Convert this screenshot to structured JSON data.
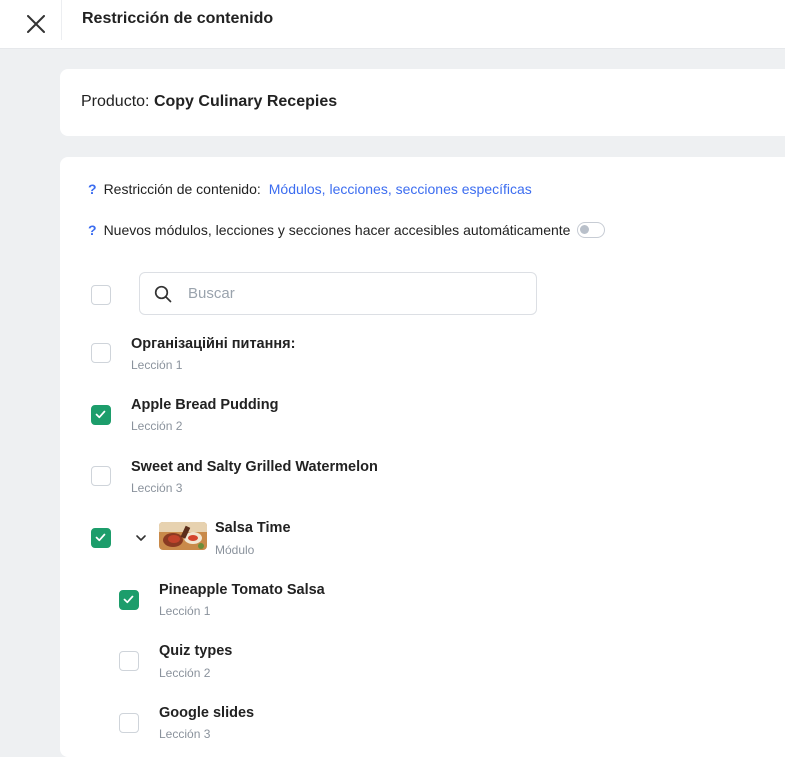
{
  "header": {
    "title": "Restricción de contenido"
  },
  "product": {
    "label": "Producto:",
    "name": "Copy Culinary Recepies"
  },
  "restriction": {
    "help": "?",
    "label": "Restricción de contenido:",
    "value": "Módulos, lecciones, secciones específicas"
  },
  "auto_access": {
    "help": "?",
    "label": "Nuevos módulos, lecciones y secciones hacer accesibles automáticamente",
    "enabled": false
  },
  "search": {
    "placeholder": "Buscar",
    "value": ""
  },
  "select_all": {
    "checked": false
  },
  "items": [
    {
      "title": "Організаційні питання:",
      "subtitle": "Lección 1",
      "checked": false
    },
    {
      "title": "Apple Bread Pudding",
      "subtitle": "Lección 2",
      "checked": true
    },
    {
      "title": "Sweet and Salty Grilled Watermelon",
      "subtitle": "Lección 3",
      "checked": false
    },
    {
      "title": "Salsa Time",
      "subtitle": "Módulo",
      "checked": true,
      "expanded": true,
      "thumbnail": "salsa-image",
      "children": [
        {
          "title": "Pineapple Tomato Salsa",
          "subtitle": "Lección 1",
          "checked": true
        },
        {
          "title": "Quiz types",
          "subtitle": "Lección 2",
          "checked": false
        },
        {
          "title": "Google slides",
          "subtitle": "Lección 3",
          "checked": false
        }
      ]
    }
  ],
  "icons": {
    "close": "close-icon",
    "search": "search-icon",
    "check": "check-icon",
    "chevron": "chevron-down-icon"
  },
  "colors": {
    "accent": "#3c6df0",
    "checked": "#1c9d6b",
    "background": "#eef0f2"
  }
}
